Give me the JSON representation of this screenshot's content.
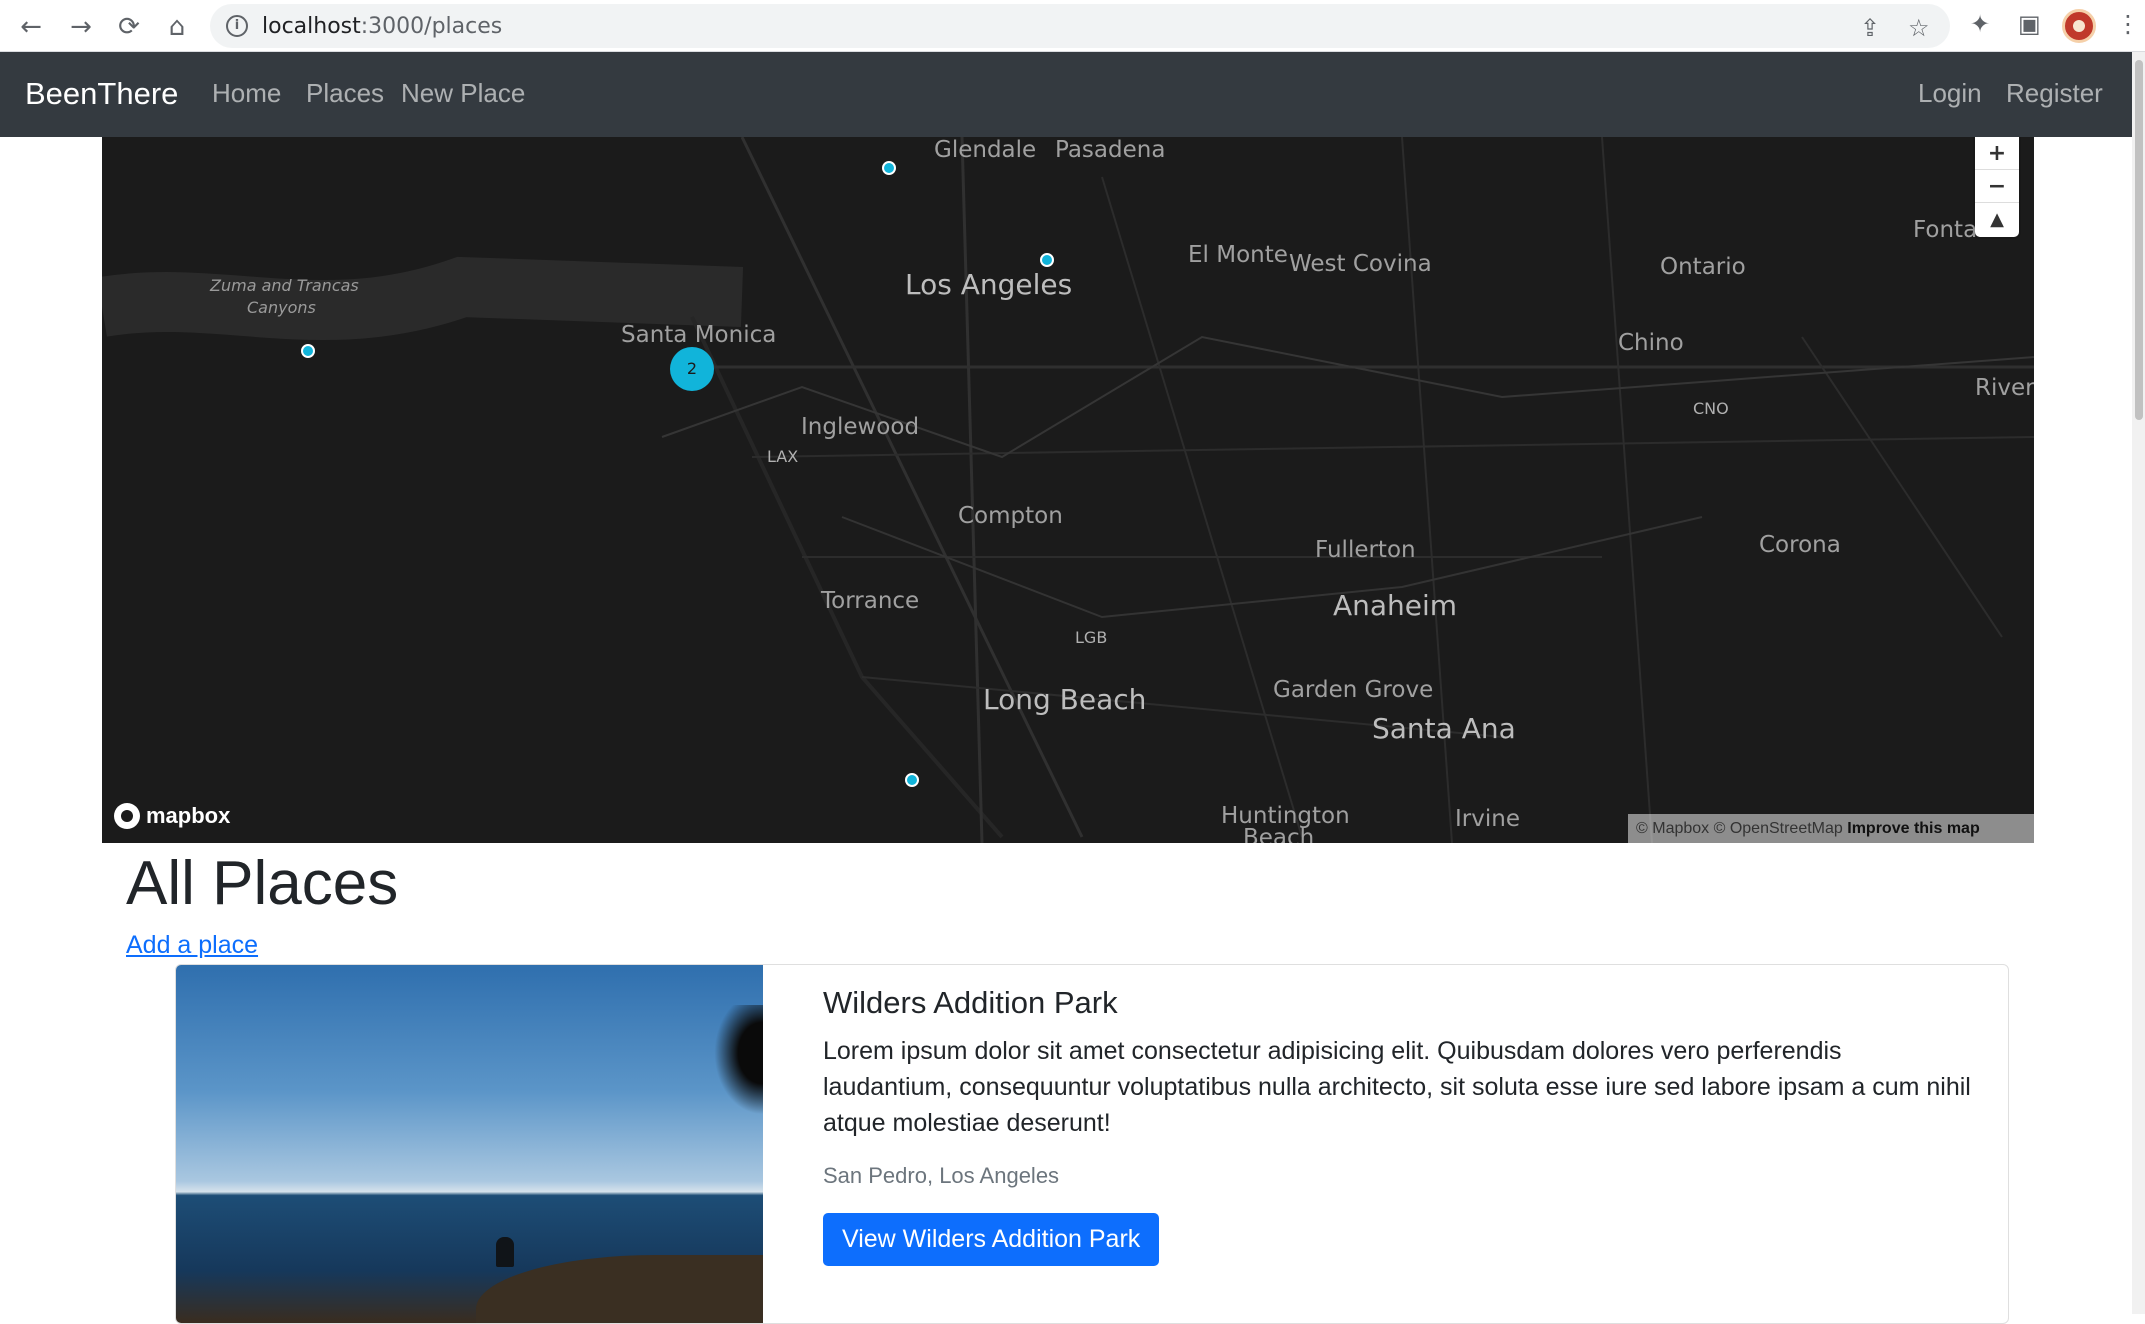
{
  "browser": {
    "url_host": "localhost",
    "url_path": ":3000/places"
  },
  "navbar": {
    "brand": "BeenThere",
    "links": [
      "Home",
      "Places",
      "New Place"
    ],
    "auth_links": [
      "Login",
      "Register"
    ]
  },
  "map": {
    "labels": {
      "glendale": "Glendale",
      "pasadena": "Pasadena",
      "los_angeles": "Los Angeles",
      "el_monte": "El Monte",
      "west_covina": "West Covina",
      "ontario": "Ontario",
      "fontana": "Fontar",
      "zuma": "Zuma and Trancas",
      "canyons": "Canyons",
      "santa_monica": "Santa Monica",
      "chino": "Chino",
      "riverside": "River",
      "cno": "CNO",
      "inglewood": "Inglewood",
      "lax": "LAX",
      "compton": "Compton",
      "fullerton": "Fullerton",
      "corona": "Corona",
      "torrance": "Torrance",
      "anaheim": "Anaheim",
      "lgb": "LGB",
      "long_beach": "Long Beach",
      "garden_grove": "Garden Grove",
      "santa_ana": "Santa Ana",
      "huntington": "Huntington",
      "beach": "Beach",
      "irvine": "Irvine"
    },
    "cluster_count": "2",
    "logo": "mapbox",
    "attribution": "© Mapbox © OpenStreetMap",
    "improve": "Improve this map",
    "marker_color": "#11b4da"
  },
  "page": {
    "title": "All Places",
    "add_link": "Add a place"
  },
  "places": [
    {
      "title": "Wilders Addition Park",
      "description": "Lorem ipsum dolor sit amet consectetur adipisicing elit. Quibusdam dolores vero perferendis laudantium, consequuntur voluptatibus nulla architecto, sit soluta esse iure sed labore ipsam a cum nihil atque molestiae deserunt!",
      "location": "San Pedro, Los Angeles",
      "button": "View Wilders Addition Park"
    }
  ]
}
